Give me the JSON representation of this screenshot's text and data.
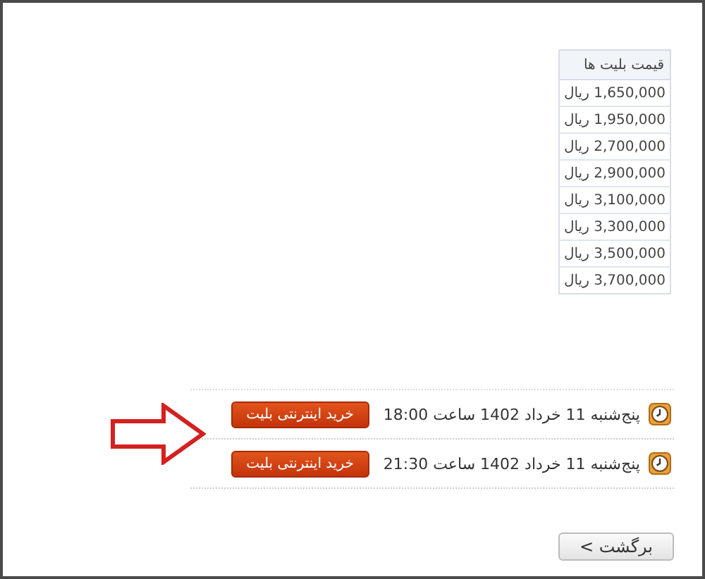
{
  "price_table": {
    "header": "قیمت بلیت ها",
    "rows": [
      "1,650,000 ریال",
      "1,950,000 ریال",
      "2,700,000 ریال",
      "2,900,000 ریال",
      "3,100,000 ریال",
      "3,300,000 ریال",
      "3,500,000 ریال",
      "3,700,000 ریال"
    ]
  },
  "showtimes": [
    {
      "time": "پنج‌شنبه 11 خرداد 1402 ساعت 18:00",
      "button": "خرید اینترنتی بلیت"
    },
    {
      "time": "پنج‌شنبه 11 خرداد 1402 ساعت 21:30",
      "button": "خرید اینترنتی بلیت"
    }
  ],
  "back_button": "< برگشت"
}
